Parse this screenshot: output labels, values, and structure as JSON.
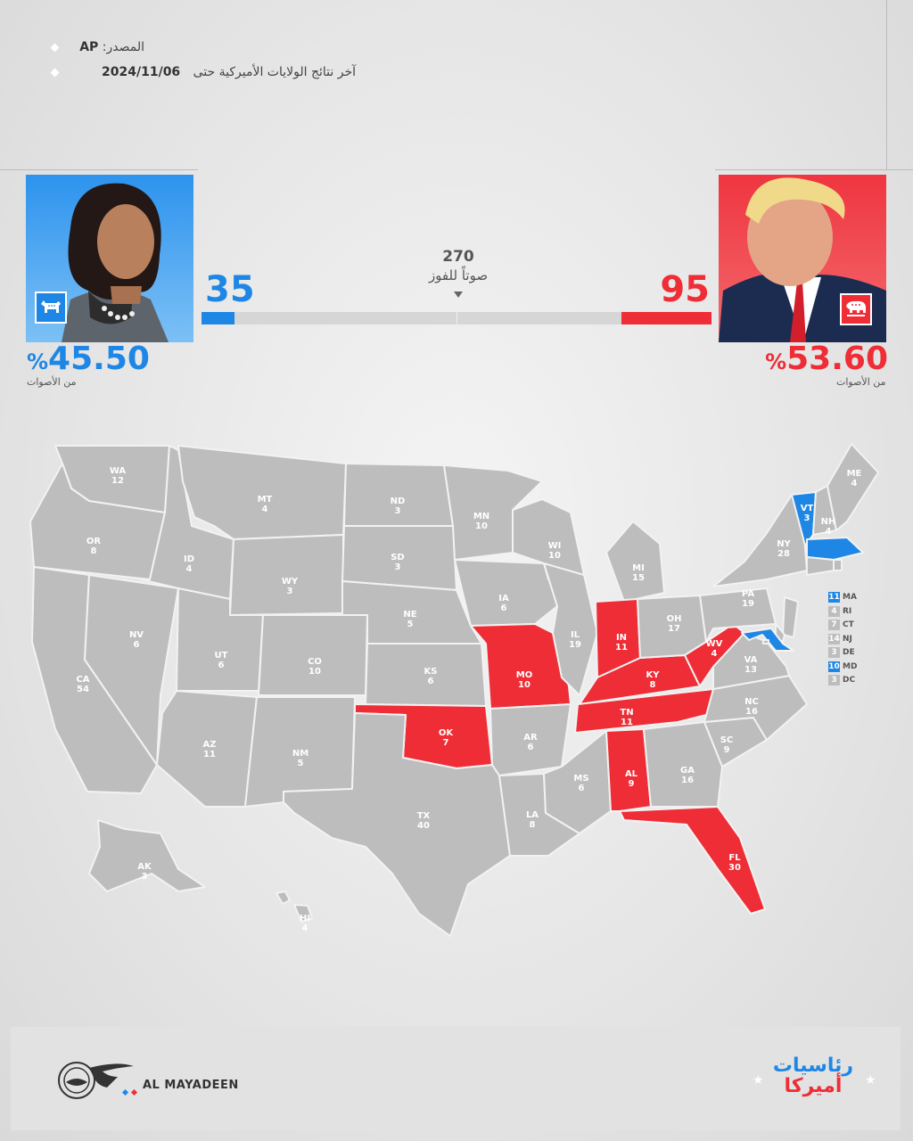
{
  "header": {
    "source_label": "المصدر:",
    "source_value": "AP",
    "results_label": "آخر نتائج الولايات الأميركية حتى",
    "results_date": "2024/11/06"
  },
  "race": {
    "target_votes": "270",
    "target_label": "صوتاً للفوز",
    "democrat": {
      "votes": "35",
      "percent": "45.50",
      "pct_sign": "%",
      "pct_label": "من الأصوات",
      "color": "#1e87e6",
      "vote_value": 35
    },
    "republican": {
      "votes": "95",
      "percent": "53.60",
      "pct_sign": "%",
      "pct_label": "من الأصوات",
      "color": "#ef2d36",
      "vote_value": 95
    },
    "total_votes": 538
  },
  "colors": {
    "dem": "#1e87e6",
    "rep": "#ef2d36",
    "undecided": "#bdbdbd"
  },
  "states": [
    {
      "abbr": "WA",
      "ev": "12",
      "status": "none"
    },
    {
      "abbr": "OR",
      "ev": "8",
      "status": "none"
    },
    {
      "abbr": "CA",
      "ev": "54",
      "status": "none"
    },
    {
      "abbr": "NV",
      "ev": "6",
      "status": "none"
    },
    {
      "abbr": "ID",
      "ev": "4",
      "status": "none"
    },
    {
      "abbr": "MT",
      "ev": "4",
      "status": "none"
    },
    {
      "abbr": "WY",
      "ev": "3",
      "status": "none"
    },
    {
      "abbr": "UT",
      "ev": "6",
      "status": "none"
    },
    {
      "abbr": "AZ",
      "ev": "11",
      "status": "none"
    },
    {
      "abbr": "CO",
      "ev": "10",
      "status": "none"
    },
    {
      "abbr": "NM",
      "ev": "5",
      "status": "none"
    },
    {
      "abbr": "ND",
      "ev": "3",
      "status": "none"
    },
    {
      "abbr": "SD",
      "ev": "3",
      "status": "none"
    },
    {
      "abbr": "NE",
      "ev": "5",
      "status": "none"
    },
    {
      "abbr": "KS",
      "ev": "6",
      "status": "none"
    },
    {
      "abbr": "OK",
      "ev": "7",
      "status": "rep"
    },
    {
      "abbr": "TX",
      "ev": "40",
      "status": "none"
    },
    {
      "abbr": "MN",
      "ev": "10",
      "status": "none"
    },
    {
      "abbr": "IA",
      "ev": "6",
      "status": "none"
    },
    {
      "abbr": "MO",
      "ev": "10",
      "status": "rep"
    },
    {
      "abbr": "AR",
      "ev": "6",
      "status": "none"
    },
    {
      "abbr": "LA",
      "ev": "8",
      "status": "none"
    },
    {
      "abbr": "WI",
      "ev": "10",
      "status": "none"
    },
    {
      "abbr": "IL",
      "ev": "19",
      "status": "none"
    },
    {
      "abbr": "MS",
      "ev": "6",
      "status": "none"
    },
    {
      "abbr": "MI",
      "ev": "15",
      "status": "none"
    },
    {
      "abbr": "IN",
      "ev": "11",
      "status": "rep"
    },
    {
      "abbr": "KY",
      "ev": "8",
      "status": "rep"
    },
    {
      "abbr": "TN",
      "ev": "11",
      "status": "rep"
    },
    {
      "abbr": "AL",
      "ev": "9",
      "status": "rep"
    },
    {
      "abbr": "OH",
      "ev": "17",
      "status": "none"
    },
    {
      "abbr": "WV",
      "ev": "4",
      "status": "rep"
    },
    {
      "abbr": "GA",
      "ev": "16",
      "status": "none"
    },
    {
      "abbr": "FL",
      "ev": "30",
      "status": "rep"
    },
    {
      "abbr": "SC",
      "ev": "9",
      "status": "none"
    },
    {
      "abbr": "NC",
      "ev": "16",
      "status": "none"
    },
    {
      "abbr": "VA",
      "ev": "13",
      "status": "none"
    },
    {
      "abbr": "PA",
      "ev": "19",
      "status": "none"
    },
    {
      "abbr": "NY",
      "ev": "28",
      "status": "none"
    },
    {
      "abbr": "VT",
      "ev": "3",
      "status": "dem"
    },
    {
      "abbr": "NH",
      "ev": "4",
      "status": "none"
    },
    {
      "abbr": "ME",
      "ev": "4",
      "status": "none"
    },
    {
      "abbr": "AK",
      "ev": "3",
      "status": "none"
    },
    {
      "abbr": "HI",
      "ev": "4",
      "status": "none"
    }
  ],
  "small_states": [
    {
      "abbr": "MA",
      "ev": "11",
      "status": "dem"
    },
    {
      "abbr": "RI",
      "ev": "4",
      "status": "none"
    },
    {
      "abbr": "CT",
      "ev": "7",
      "status": "none"
    },
    {
      "abbr": "NJ",
      "ev": "14",
      "status": "none"
    },
    {
      "abbr": "DE",
      "ev": "3",
      "status": "none"
    },
    {
      "abbr": "MD",
      "ev": "10",
      "status": "dem"
    },
    {
      "abbr": "DC",
      "ev": "3",
      "status": "none"
    }
  ],
  "footer": {
    "brand": "AL MAYADEEN",
    "logo_ar": "الميادين",
    "series_line1": "رئاسيات",
    "series_line2": "أميركا"
  }
}
